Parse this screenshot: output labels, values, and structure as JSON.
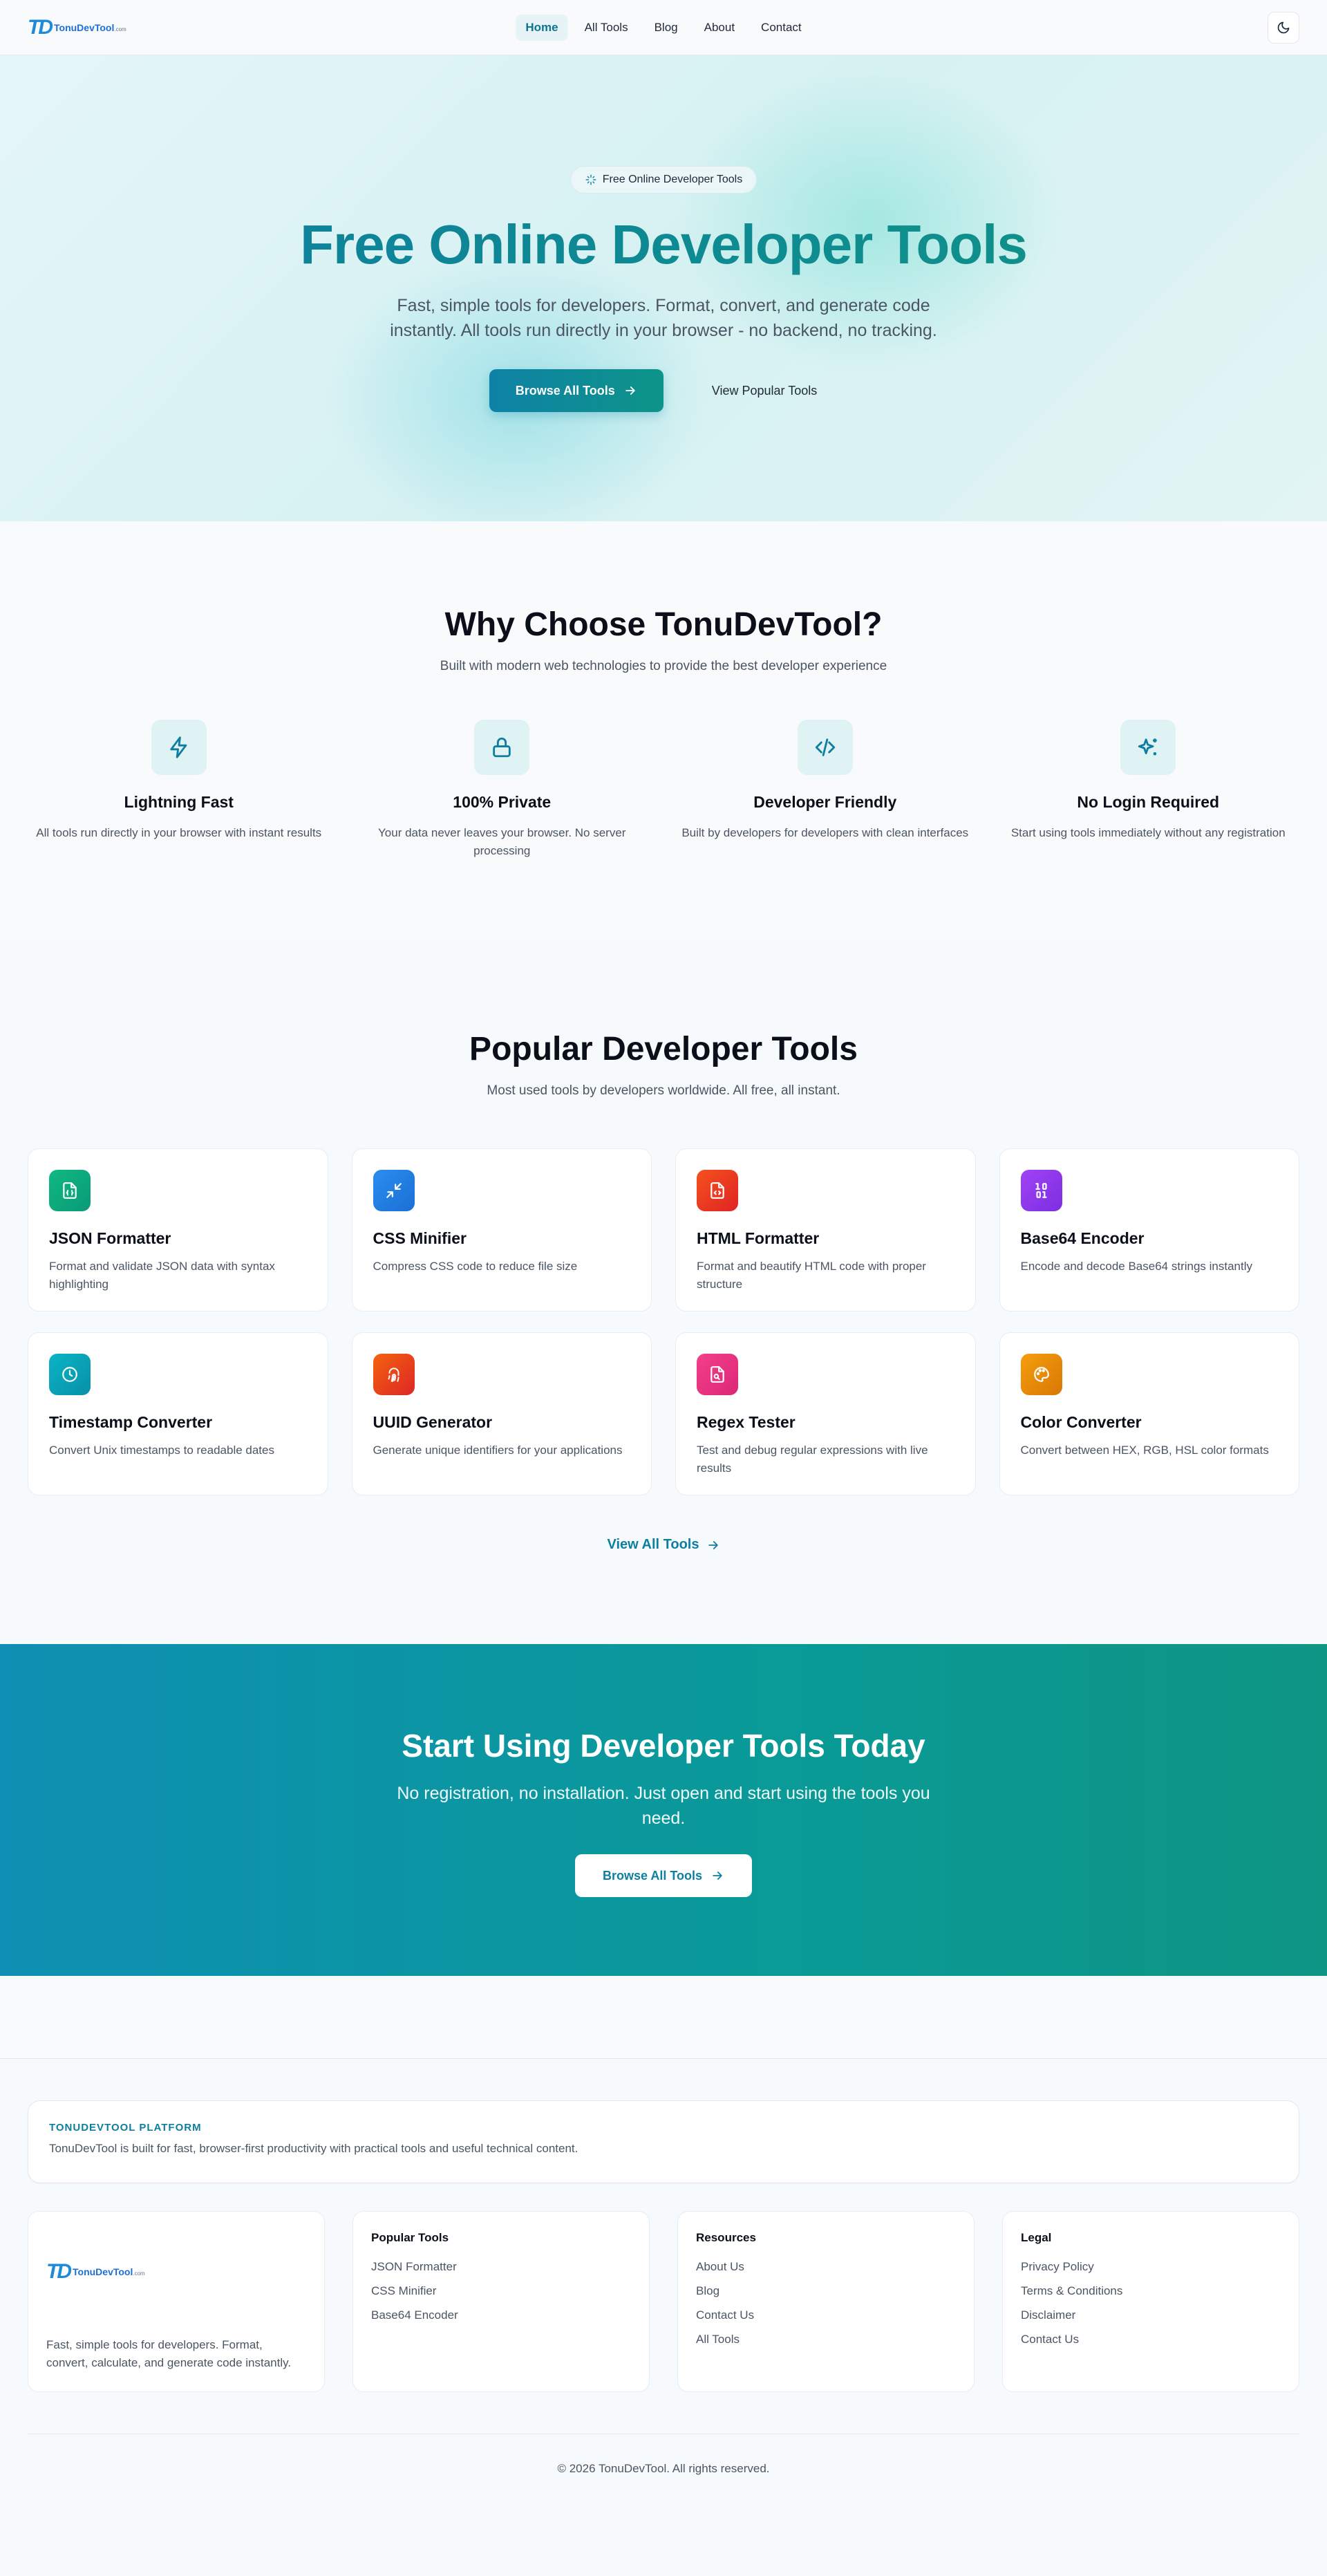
{
  "brand": {
    "mark": "TD",
    "name": "TonuDevTool",
    "suffix": ".com"
  },
  "nav": {
    "links": [
      "Home",
      "All Tools",
      "Blog",
      "About",
      "Contact"
    ],
    "active": "Home",
    "theme_icon": "moon-icon"
  },
  "hero": {
    "badge": "Free Online Developer Tools",
    "title": "Free Online Developer Tools",
    "subtitle": "Fast, simple tools for developers. Format, convert, and generate code instantly. All tools run directly in your browser - no backend, no tracking.",
    "primary_button": "Browse All Tools",
    "secondary_button": "View Popular Tools"
  },
  "why": {
    "title": "Why Choose TonuDevTool?",
    "subtitle": "Built with modern web technologies to provide the best developer experience",
    "features": [
      {
        "title": "Lightning Fast",
        "desc": "All tools run directly in your browser with instant results",
        "icon": "lightning-icon"
      },
      {
        "title": "100% Private",
        "desc": "Your data never leaves your browser. No server processing",
        "icon": "lock-icon"
      },
      {
        "title": "Developer Friendly",
        "desc": "Built by developers for developers with clean interfaces",
        "icon": "code-icon"
      },
      {
        "title": "No Login Required",
        "desc": "Start using tools immediately without any registration",
        "icon": "sparkles-icon"
      }
    ]
  },
  "popular": {
    "title": "Popular Developer Tools",
    "subtitle": "Most used tools by developers worldwide. All free, all instant.",
    "tools": [
      {
        "title": "JSON Formatter",
        "desc": "Format and validate JSON data with syntax highlighting",
        "icon": "file-json-icon",
        "color": "#10b981"
      },
      {
        "title": "CSS Minifier",
        "desc": "Compress CSS code to reduce file size",
        "icon": "minimize-icon",
        "color": "#1d7fe0"
      },
      {
        "title": "HTML Formatter",
        "desc": "Format and beautify HTML code with proper structure",
        "icon": "file-code-icon",
        "color": "#ef4444"
      },
      {
        "title": "Base64 Encoder",
        "desc": "Encode and decode Base64 strings instantly",
        "icon": "binary-icon",
        "color": "#9333ea"
      },
      {
        "title": "Timestamp Converter",
        "desc": "Convert Unix timestamps to readable dates",
        "icon": "clock-icon",
        "color": "#06a5b8"
      },
      {
        "title": "UUID Generator",
        "desc": "Generate unique identifiers for your applications",
        "icon": "fingerprint-icon",
        "color": "#ef4a1c"
      },
      {
        "title": "Regex Tester",
        "desc": "Test and debug regular expressions with live results",
        "icon": "file-search-icon",
        "color": "#ec2d7a"
      },
      {
        "title": "Color Converter",
        "desc": "Convert between HEX, RGB, HSL color formats",
        "icon": "palette-icon",
        "color": "#ea8a06"
      }
    ],
    "view_all": "View All Tools"
  },
  "cta": {
    "title": "Start Using Developer Tools Today",
    "subtitle": "No registration, no installation. Just open and start using the tools you need.",
    "button": "Browse All Tools"
  },
  "footer": {
    "platform_label": "TONUDEVTOOL PLATFORM",
    "platform_text": "TonuDevTool is built for fast, browser-first productivity with practical tools and useful technical content.",
    "brand_desc": "Fast, simple tools for developers. Format, convert, calculate, and generate code instantly.",
    "columns": [
      {
        "title": "Popular Tools",
        "items": [
          "JSON Formatter",
          "CSS Minifier",
          "Base64 Encoder"
        ]
      },
      {
        "title": "Resources",
        "items": [
          "About Us",
          "Blog",
          "Contact Us",
          "All Tools"
        ]
      },
      {
        "title": "Legal",
        "items": [
          "Privacy Policy",
          "Terms & Conditions",
          "Disclaimer",
          "Contact Us"
        ]
      }
    ],
    "copyright": "© 2026 TonuDevTool. All rights reserved."
  },
  "colors": {
    "accent": "#0e7ea0",
    "accent2": "#0d9488",
    "text": "#1f2937",
    "muted": "#4b5563"
  }
}
